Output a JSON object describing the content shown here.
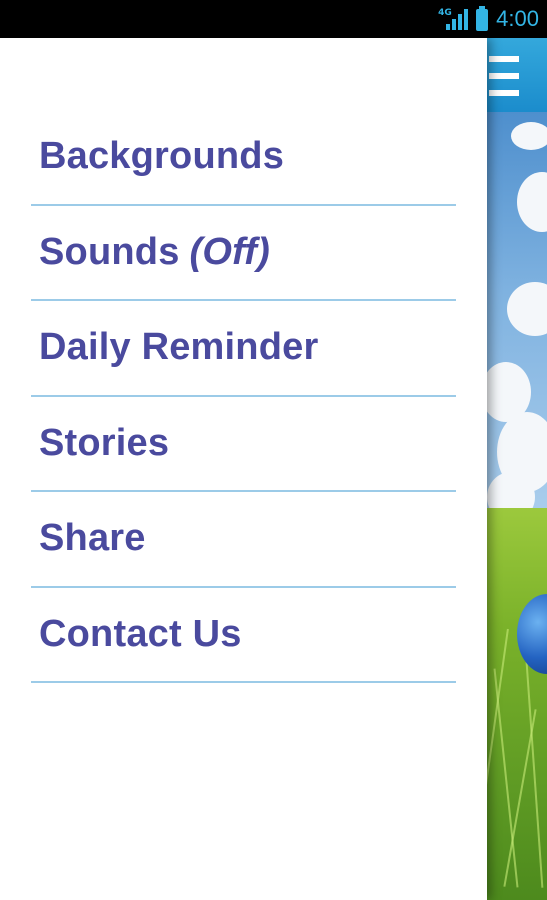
{
  "status_bar": {
    "network_type": "4G",
    "time": "4:00",
    "icons": [
      "signal-icon",
      "battery-icon"
    ]
  },
  "drawer": {
    "items": [
      {
        "label": "Backgrounds",
        "suffix": ""
      },
      {
        "label": "Sounds",
        "suffix": "(Off)"
      },
      {
        "label": "Daily Reminder",
        "suffix": ""
      },
      {
        "label": "Stories",
        "suffix": ""
      },
      {
        "label": "Share",
        "suffix": ""
      },
      {
        "label": "Contact Us",
        "suffix": ""
      }
    ]
  },
  "app_bar": {
    "menu_icon": "hamburger-menu-icon"
  },
  "colors": {
    "status_accent": "#33b5e5",
    "menu_text": "#4a4a9e",
    "divider": "#9ccbe8",
    "app_bar": "#2a9ad6",
    "status_bar": "#000000"
  }
}
